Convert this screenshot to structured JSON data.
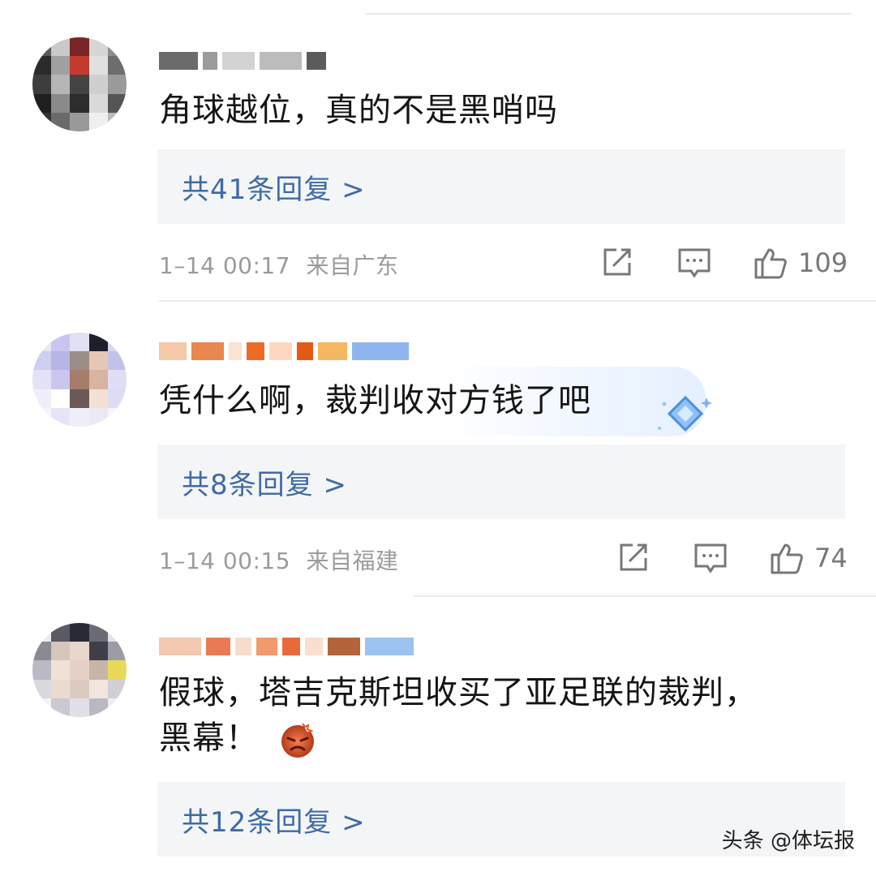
{
  "comments": [
    {
      "text": "角球越位，真的不是黑哨吗",
      "replies_label": "共41条回复 >",
      "time": "1–14 00:17",
      "location": "来自广东",
      "likes": "109"
    },
    {
      "text": "凭什么啊，裁判收对方钱了吧",
      "replies_label": "共8条回复 >",
      "time": "1–14 00:15",
      "location": "来自福建",
      "likes": "74"
    },
    {
      "text_line1": "假球，塔吉克斯坦收买了亚足联的裁判，",
      "text_line2": "黑幕！",
      "replies_label": "共12条回复 >"
    }
  ],
  "icons": {
    "share": "share-icon",
    "reply": "comment-icon",
    "like": "thumbs-up-icon",
    "angry_emoji": "angry-face-emoji",
    "vip_badge": "diamond-badge-icon"
  },
  "colors": {
    "reply_link": "#3e6ba6",
    "reply_bg": "#f4f5f7",
    "meta": "#9b9b9b"
  },
  "watermark": "头条 @体坛报"
}
